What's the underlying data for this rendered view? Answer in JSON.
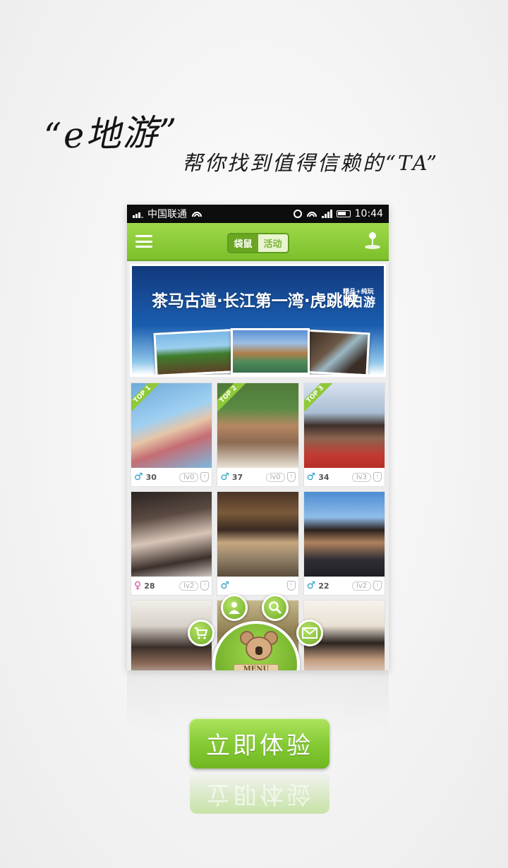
{
  "headline": {
    "title": "“e地游”",
    "subtitle": "帮你找到值得信赖的“TA”"
  },
  "status_bar": {
    "carrier": "中国联通",
    "time": "10:44"
  },
  "app_bar": {
    "seg_left": "袋鼠",
    "seg_right": "活动"
  },
  "banner": {
    "title": "茶马古道·长江第一湾·虎跳峡",
    "tag_small": "精品+纯玩",
    "tag_big": "7日游"
  },
  "cards": [
    {
      "age": "30",
      "gender": "♂",
      "level": "lv0",
      "top": "TOP 1"
    },
    {
      "age": "37",
      "gender": "♂",
      "level": "lv0",
      "top": "TOP 2"
    },
    {
      "age": "34",
      "gender": "♂",
      "level": "lv3",
      "top": "TOP 3"
    },
    {
      "age": "28",
      "gender": "♀",
      "level": "lv2",
      "top": ""
    },
    {
      "age": "",
      "gender": "♂",
      "level": "",
      "top": ""
    },
    {
      "age": "22",
      "gender": "♂",
      "level": "lv2",
      "top": ""
    }
  ],
  "menu": {
    "label": "MENU"
  },
  "cta": {
    "label": "立即体验"
  },
  "colors": {
    "accent_green": "#86cb35",
    "male": "#2a9fc4",
    "female": "#d6479a"
  }
}
